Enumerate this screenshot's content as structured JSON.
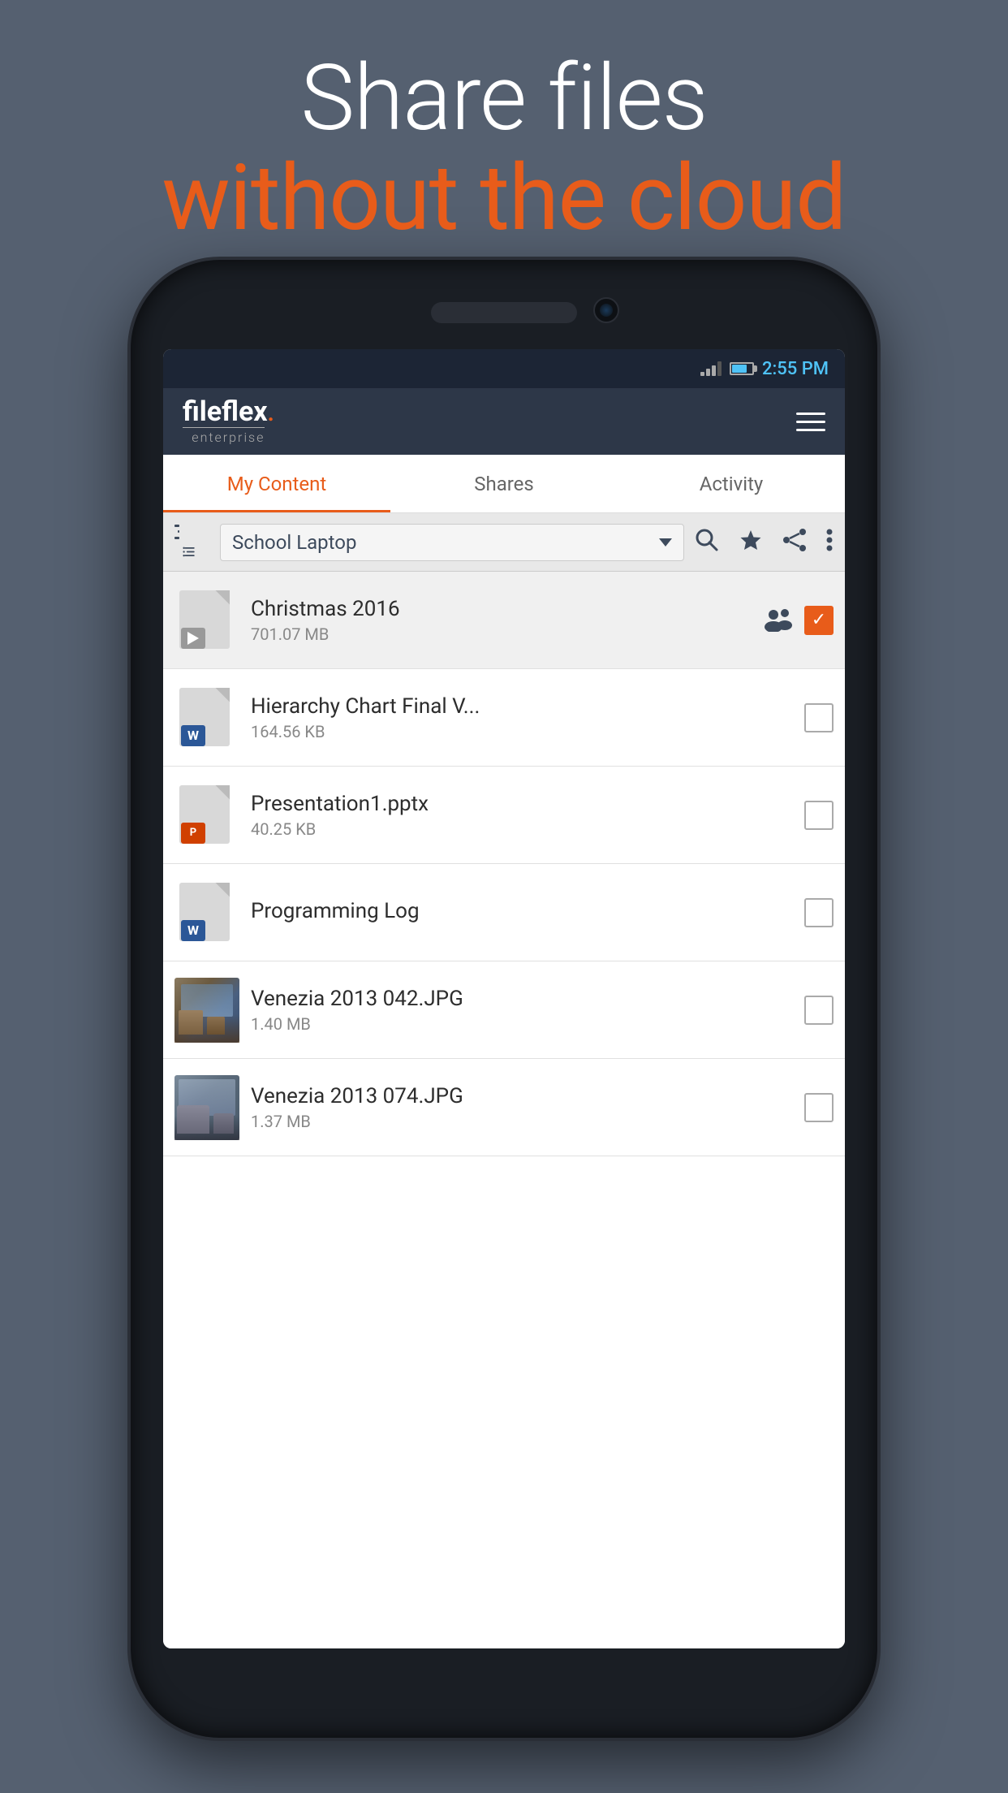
{
  "hero": {
    "line1": "Share files",
    "line2": "without the cloud"
  },
  "status_bar": {
    "time": "2:55 PM"
  },
  "app_header": {
    "logo_main": "fileflex",
    "logo_trademark": ".",
    "logo_sub": "enterprise",
    "menu_label": "Menu"
  },
  "tabs": [
    {
      "id": "my-content",
      "label": "My Content",
      "active": true
    },
    {
      "id": "shares",
      "label": "Shares",
      "active": false
    },
    {
      "id": "activity",
      "label": "Activity",
      "active": false
    }
  ],
  "toolbar": {
    "source_name": "School Laptop",
    "search_label": "Search",
    "favorites_label": "Favorites",
    "share_label": "Share",
    "more_label": "More options"
  },
  "files": [
    {
      "id": "christmas-2016",
      "name": "Christmas 2016",
      "size": "701.07 MB",
      "type": "video",
      "selected": true,
      "shared": true
    },
    {
      "id": "hierarchy-chart",
      "name": "Hierarchy Chart Final V...",
      "size": "164.56 KB",
      "type": "word",
      "selected": false,
      "shared": false
    },
    {
      "id": "presentation1",
      "name": "Presentation1.pptx",
      "size": "40.25 KB",
      "type": "ppt",
      "selected": false,
      "shared": false
    },
    {
      "id": "programming-log",
      "name": "Programming Log",
      "size": "",
      "type": "word",
      "selected": false,
      "shared": false
    },
    {
      "id": "venezia-042",
      "name": "Venezia 2013 042.JPG",
      "size": "1.40 MB",
      "type": "image",
      "selected": false,
      "shared": false
    },
    {
      "id": "venezia-074",
      "name": "Venezia 2013 074.JPG",
      "size": "1.37 MB",
      "type": "image",
      "selected": false,
      "shared": false
    }
  ],
  "colors": {
    "accent": "#e85c1a",
    "header_bg": "#2d3748",
    "tab_active": "#e85c1a",
    "toolbar_bg": "#e8e8e8",
    "bg_dark": "#556070"
  }
}
